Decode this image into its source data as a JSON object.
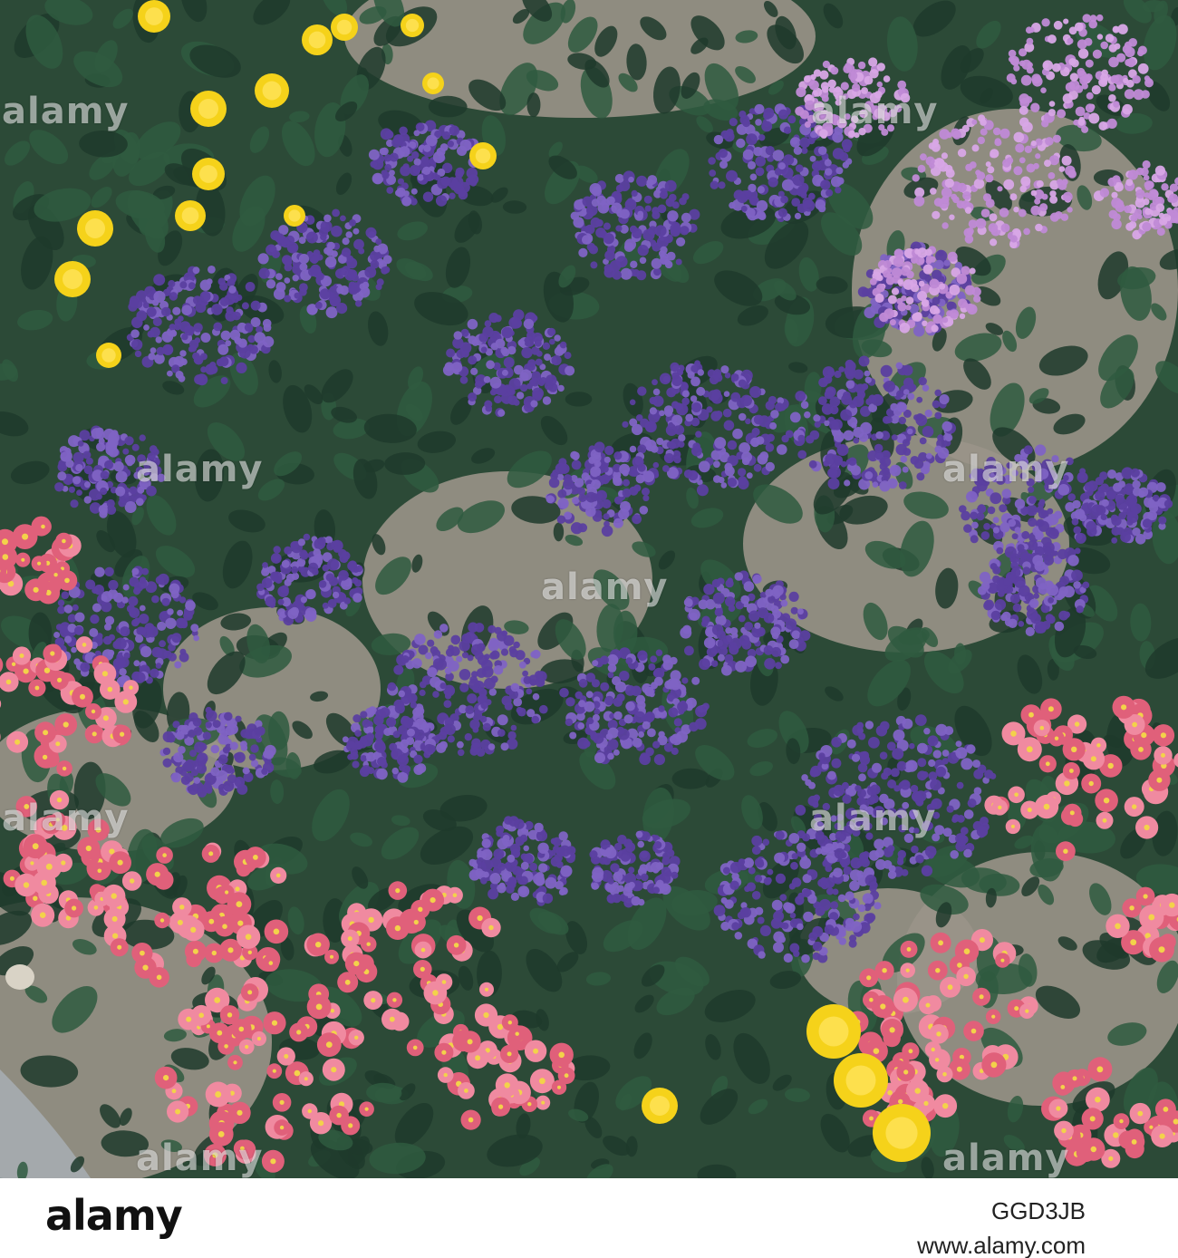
{
  "image": {
    "description_colors": {
      "soil": "#9a9488",
      "foliage_dark": "#1f3a2c",
      "foliage": "#2f5a40",
      "heliotrope": "#5b3fa0",
      "heliotrope_light": "#7f63c4",
      "ageratum": "#c08ad6",
      "begonia": "#e0607a",
      "begonia_light": "#f08aa0",
      "marigold": "#f5d21a"
    }
  },
  "watermarks": {
    "overlay_text": "alamy"
  },
  "footer": {
    "logo": "alamy",
    "image_id": "GGD3JB",
    "site": "www.alamy.com"
  }
}
